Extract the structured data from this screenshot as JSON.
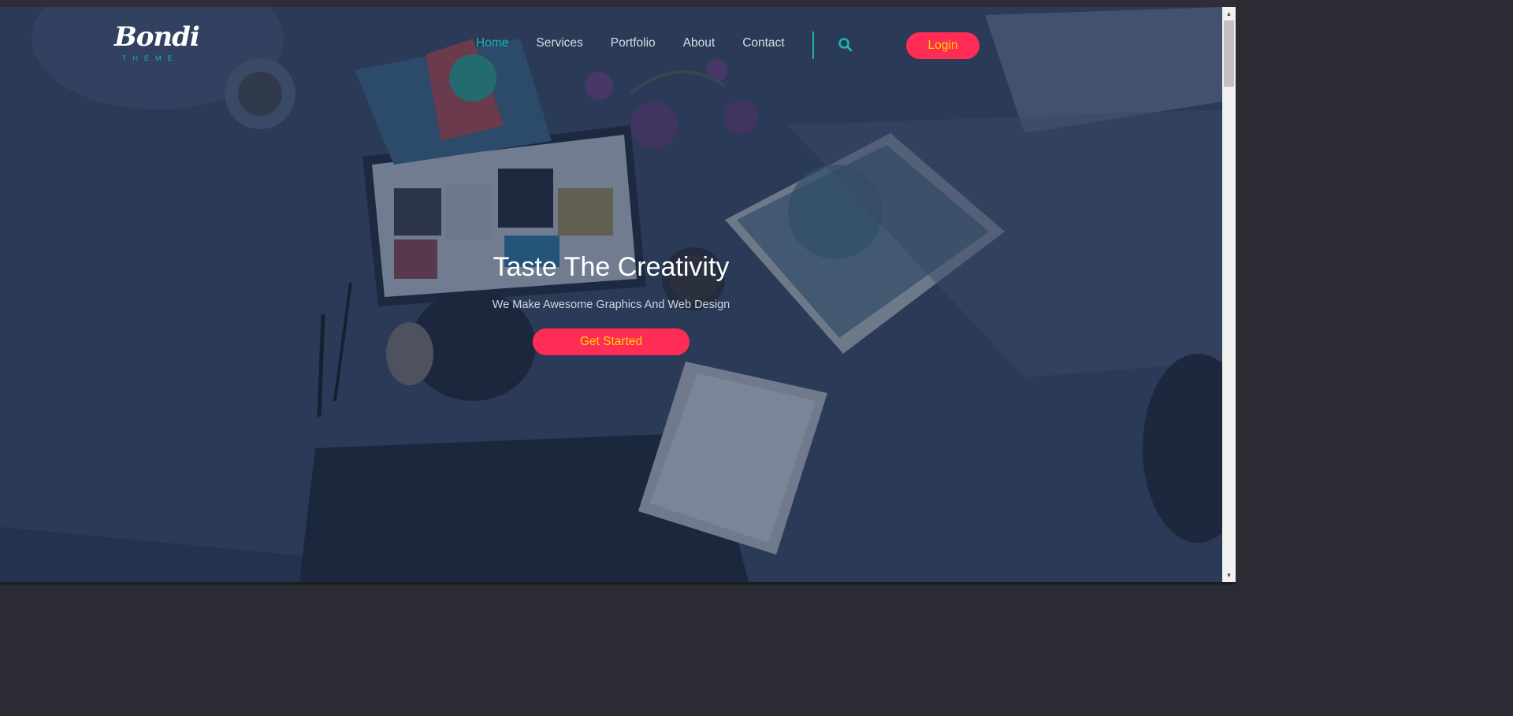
{
  "logo": {
    "wordmark": "Bondi",
    "subtitle": "THEME"
  },
  "nav": {
    "items": [
      {
        "label": "Home",
        "active": true
      },
      {
        "label": "Services",
        "active": false
      },
      {
        "label": "Portfolio",
        "active": false
      },
      {
        "label": "About",
        "active": false
      },
      {
        "label": "Contact",
        "active": false
      }
    ],
    "search_icon": "search-icon",
    "login_label": "Login"
  },
  "hero": {
    "title": "Taste The Creativity",
    "subtitle": "We Make Awesome Graphics And Web Design",
    "cta_label": "Get Started"
  },
  "scrollbar": {
    "up_icon": "▲",
    "down_icon": "▼"
  },
  "colors": {
    "accent_teal": "#19b6b3",
    "button_red": "#ff2d55",
    "button_text_yellow": "#ffd400",
    "overlay": "#243450"
  }
}
